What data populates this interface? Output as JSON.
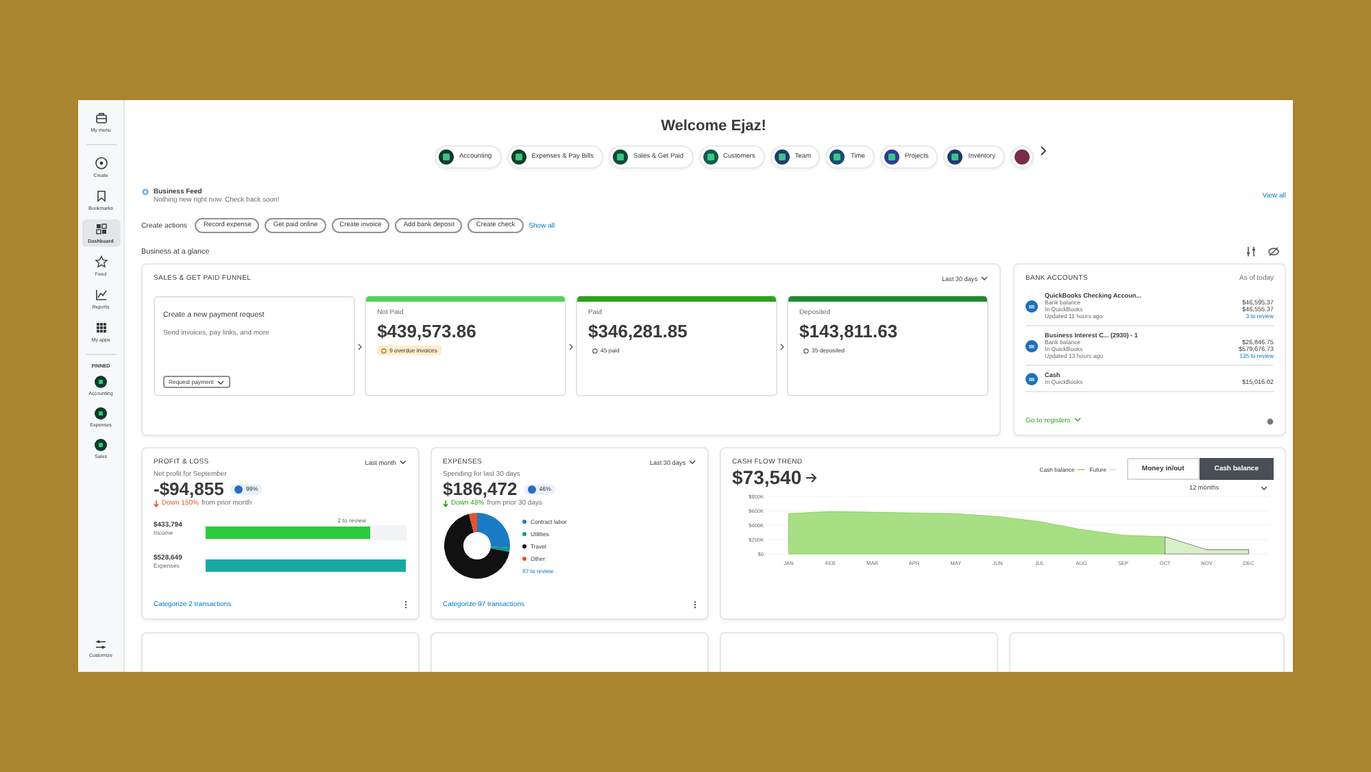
{
  "sidebar": {
    "items": [
      {
        "label": "My menu",
        "selected": false
      },
      {
        "label": "Create",
        "selected": false
      },
      {
        "label": "Bookmarks",
        "selected": false
      },
      {
        "label": "Dashboard",
        "selected": true
      },
      {
        "label": "Feed",
        "selected": false
      },
      {
        "label": "Reports",
        "selected": false
      },
      {
        "label": "My apps",
        "selected": false
      }
    ],
    "pinned_label": "PINNED",
    "pinned": [
      {
        "label": "Accounting"
      },
      {
        "label": "Expenses"
      },
      {
        "label": "Sales"
      }
    ],
    "footer": "Customize"
  },
  "header": {
    "title": "Welcome Ejaz!",
    "pills": [
      {
        "label": "Accounting",
        "color": "#0b3b2e"
      },
      {
        "label": "Expenses & Pay Bills",
        "color": "#0d3f26"
      },
      {
        "label": "Sales & Get Paid",
        "color": "#0d4a3a"
      },
      {
        "label": "Customers",
        "color": "#0f5c4a"
      },
      {
        "label": "Team",
        "color": "#1b3d6b"
      },
      {
        "label": "Time",
        "color": "#174d6e"
      },
      {
        "label": "Projects",
        "color": "#2b3f8f"
      },
      {
        "label": "Inventory",
        "color": "#23386e"
      }
    ]
  },
  "feed": {
    "title": "Business Feed",
    "message": "Nothing new right now. Check back soon!",
    "link": "View all"
  },
  "create_actions": {
    "label": "Create actions",
    "buttons": [
      "Record expense",
      "Get paid online",
      "Create invoice",
      "Add bank deposit",
      "Create check"
    ],
    "link": "Show all"
  },
  "glance_title": "Business at a glance",
  "funnel": {
    "title": "SALES & GET PAID FUNNEL",
    "period": "Last 30 days",
    "request": {
      "title": "Create a new payment request",
      "text": "Send invoices, pay links, and more",
      "button": "Request payment"
    },
    "stages": [
      {
        "label": "Not Paid",
        "amount": "$439,573.86",
        "note": "9 overdue invoices",
        "kind": "warning",
        "color": "#53d15c"
      },
      {
        "label": "Paid",
        "amount": "$346,281.85",
        "note": "45 paid",
        "kind": "ok",
        "color": "#2ca01c"
      },
      {
        "label": "Deposited",
        "amount": "$143,811.63",
        "note": "35 deposited",
        "kind": "ok",
        "color": "#1f8a2e"
      }
    ]
  },
  "bank": {
    "title": "BANK ACCOUNTS",
    "as_of": "As of today",
    "accounts": [
      {
        "name": "QuickBooks Checking Accoun...",
        "lines": [
          "Bank balance",
          "In QuickBooks",
          "Updated 11 hours ago"
        ],
        "amounts": [
          "$46,595.37",
          "$46,555.37"
        ],
        "review": "3 to review"
      },
      {
        "name": "Business Interest C... (2930) - 1",
        "lines": [
          "Bank balance",
          "In QuickBooks",
          "Updated 13 hours ago"
        ],
        "amounts": [
          "$26,846.75",
          "$579,676.73"
        ],
        "review": "135 to review"
      },
      {
        "name": "Cash",
        "lines": [
          "In QuickBooks"
        ],
        "amounts": [
          "$15,016.02"
        ]
      }
    ],
    "link": "Go to registers"
  },
  "profit_loss": {
    "title": "PROFIT & LOSS",
    "period": "Last month",
    "subtitle": "Net profit for September",
    "amount": "-$94,855",
    "badge": "99%",
    "trend_value": "Down 150%",
    "trend_text": "from prior month",
    "bars": [
      {
        "amount": "$433,794",
        "label": "Income",
        "level": 0.82,
        "color": "#2ccb3c",
        "note": "2 to review"
      },
      {
        "amount": "$528,649",
        "label": "Expenses",
        "level": 1,
        "color": "#17a9a0"
      }
    ],
    "link": "Categorize 2 transactions"
  },
  "expenses": {
    "title": "EXPENSES",
    "period": "Last 30 days",
    "subtitle": "Spending for last 30 days",
    "amount": "$186,472",
    "badge": "46%",
    "trend_value": "Down 48%",
    "trend_text": "from prior 30 days",
    "legend": [
      {
        "label": "Contract labor",
        "color": "#1a7bc4"
      },
      {
        "label": "Utilities",
        "color": "#0f9a8a"
      },
      {
        "label": "Travel",
        "color": "#111111"
      },
      {
        "label": "Other",
        "color": "#e5532b"
      }
    ],
    "review": "97 to review",
    "link": "Categorize 97 transactions"
  },
  "cash_flow": {
    "title": "CASH FLOW TREND",
    "amount": "$73,540",
    "toggle": [
      {
        "label": "Money in/out",
        "selected": false
      },
      {
        "label": "Cash balance",
        "selected": true
      }
    ],
    "range": "12 months",
    "chart_data": {
      "type": "area",
      "categories": [
        "JAN",
        "FEB",
        "MAR",
        "APR",
        "MAY",
        "JUN",
        "JUL",
        "AUG",
        "SEP",
        "OCT",
        "NOV",
        "DEC"
      ],
      "series": [
        {
          "name": "Cash balance",
          "color": "#a9df84",
          "values": [
            560000,
            590000,
            580000,
            570000,
            560000,
            520000,
            450000,
            340000,
            260000,
            240000,
            null,
            null
          ]
        },
        {
          "name": "Future",
          "color": "#d7f0c8",
          "values": [
            null,
            null,
            null,
            null,
            null,
            null,
            null,
            null,
            null,
            240000,
            60000,
            60000
          ]
        }
      ],
      "ylim": [
        0,
        800000
      ],
      "grid": true,
      "yticks": [
        {
          "value": 0,
          "label": "$0"
        },
        {
          "value": 200000,
          "label": "$200K"
        },
        {
          "value": 400000,
          "label": "$400K"
        },
        {
          "value": 600000,
          "label": "$600K"
        },
        {
          "value": 800000,
          "label": "$800K"
        }
      ]
    }
  }
}
